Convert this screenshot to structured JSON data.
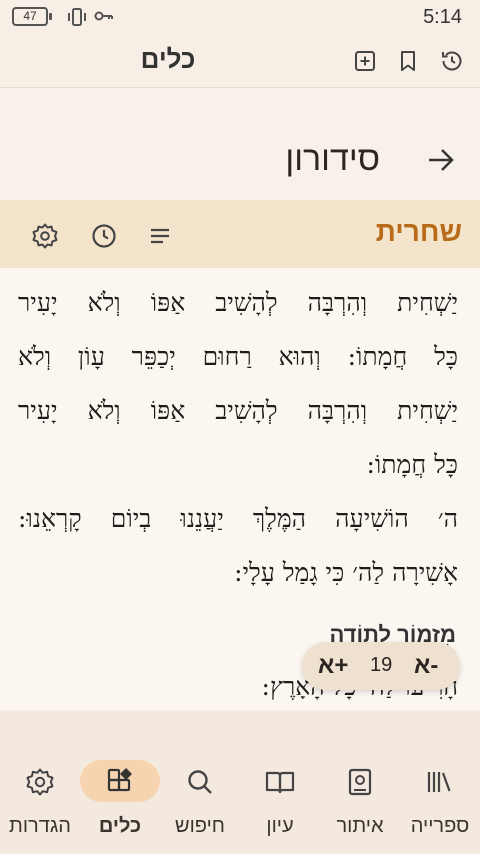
{
  "status_bar": {
    "battery": "47",
    "time": "5:14",
    "icons": [
      "vibrate-icon",
      "vpn-key-icon"
    ]
  },
  "app_header": {
    "title": "כלים",
    "icons": [
      "add-box-icon",
      "bookmark-icon",
      "history-icon"
    ]
  },
  "siddur": {
    "name": "סידורון",
    "back_icon": "arrow-right-icon"
  },
  "section": {
    "title": "שחרית",
    "icons": [
      "menu-list-icon",
      "clock-icon",
      "settings-icon"
    ]
  },
  "text": {
    "lines": [
      "יַשְׁחִית וְהִרְבָּה לְהָשִׁיב אַפּוֹ וְלֹא יָעִיר",
      "כָּל חֲמָתוֹ: וְהוּא רַחוּם יְכַפֵּר עָוֹן וְלֹא",
      "יַשְׁחִית וְהִרְבָּה לְהָשִׁיב אַפּוֹ וְלֹא יָעִיר",
      "כָּל חֲמָתוֹ:",
      "ה׳ הוֹשִׁיעָה הַמֶּלֶךְ יַעֲנֵנוּ בְיוֹם קָרְאֵנוּ:",
      "אָשִׁירָה לַה׳ כִּי גָמַל עָלָי:"
    ],
    "subheading": "מִזְמוֹר לְתוֹדָה",
    "last_line": "הָרִיעוּ לַה׳ כָּל הָאָרֶץ:"
  },
  "font_control": {
    "increase": "א+",
    "size": "19",
    "decrease": "א-"
  },
  "bottom_nav": {
    "items": [
      {
        "label": "ספרייה",
        "icon": "library-icon"
      },
      {
        "label": "איתור",
        "icon": "find-book-icon"
      },
      {
        "label": "עיון",
        "icon": "open-book-icon"
      },
      {
        "label": "חיפוש",
        "icon": "search-icon"
      },
      {
        "label": "כלים",
        "icon": "tools-icon",
        "active": true
      },
      {
        "label": "הגדרות",
        "icon": "settings-icon"
      }
    ]
  },
  "colors": {
    "accent": "#b86b18",
    "active_nav_bg": "#f6d4b0",
    "section_bar": "#f5e4cc"
  }
}
